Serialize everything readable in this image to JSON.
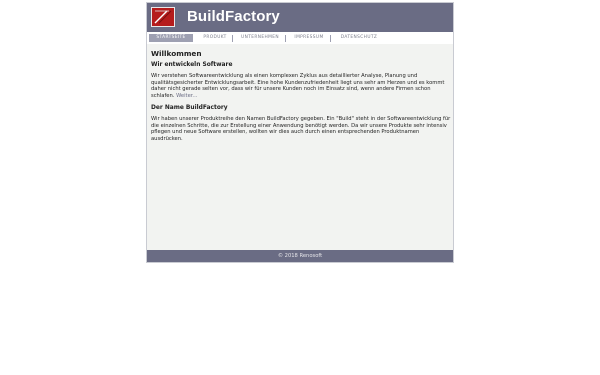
{
  "brand": {
    "name": "BuildFactory",
    "icon": "buildfactory-logo"
  },
  "nav": [
    {
      "label": "STARTSEITE",
      "active": true
    },
    {
      "label": "PRODUKT",
      "active": false
    },
    {
      "label": "UNTERNEHMEN",
      "active": false
    },
    {
      "label": "IMPRESSUM",
      "active": false
    },
    {
      "label": "DATENSCHUTZ",
      "active": false
    }
  ],
  "content": {
    "title": "Willkommen",
    "section1": {
      "heading": "Wir entwickeln Software",
      "text": "Wir verstehen Softwareentwicklung als einen komplexen Zyklus aus detaillierter Analyse, Planung und qualitätsgesicherter Entwicklungsarbeit. Eine hohe Kundenzufriedenheit liegt uns sehr am Herzen und es kommt daher nicht gerade selten vor, dass wir für unsere Kunden noch im Einsatz sind, wenn andere Firmen schon schlafen.",
      "more_link": "Weiter..."
    },
    "section2": {
      "heading": "Der Name BuildFactory",
      "text": "Wir haben unserer Produktreihe den Namen BuildFactory gegeben. Ein \"Build\" steht in der Softwareentwicklung für die einzelnen Schritte, die zur Erstellung einer Anwendung benötigt werden. Da wir unsere Produkte sehr intensiv pflegen und neue Software erstellen, wollten wir dies auch durch einen entsprechenden Produktnamen ausdrücken."
    }
  },
  "footer": {
    "text": "© 2018 Renosoft"
  },
  "colors": {
    "header": "#6a6c84",
    "accent": "#b51c1c",
    "nav_active": "#9ea0b2",
    "background": "#f2f3f1"
  }
}
